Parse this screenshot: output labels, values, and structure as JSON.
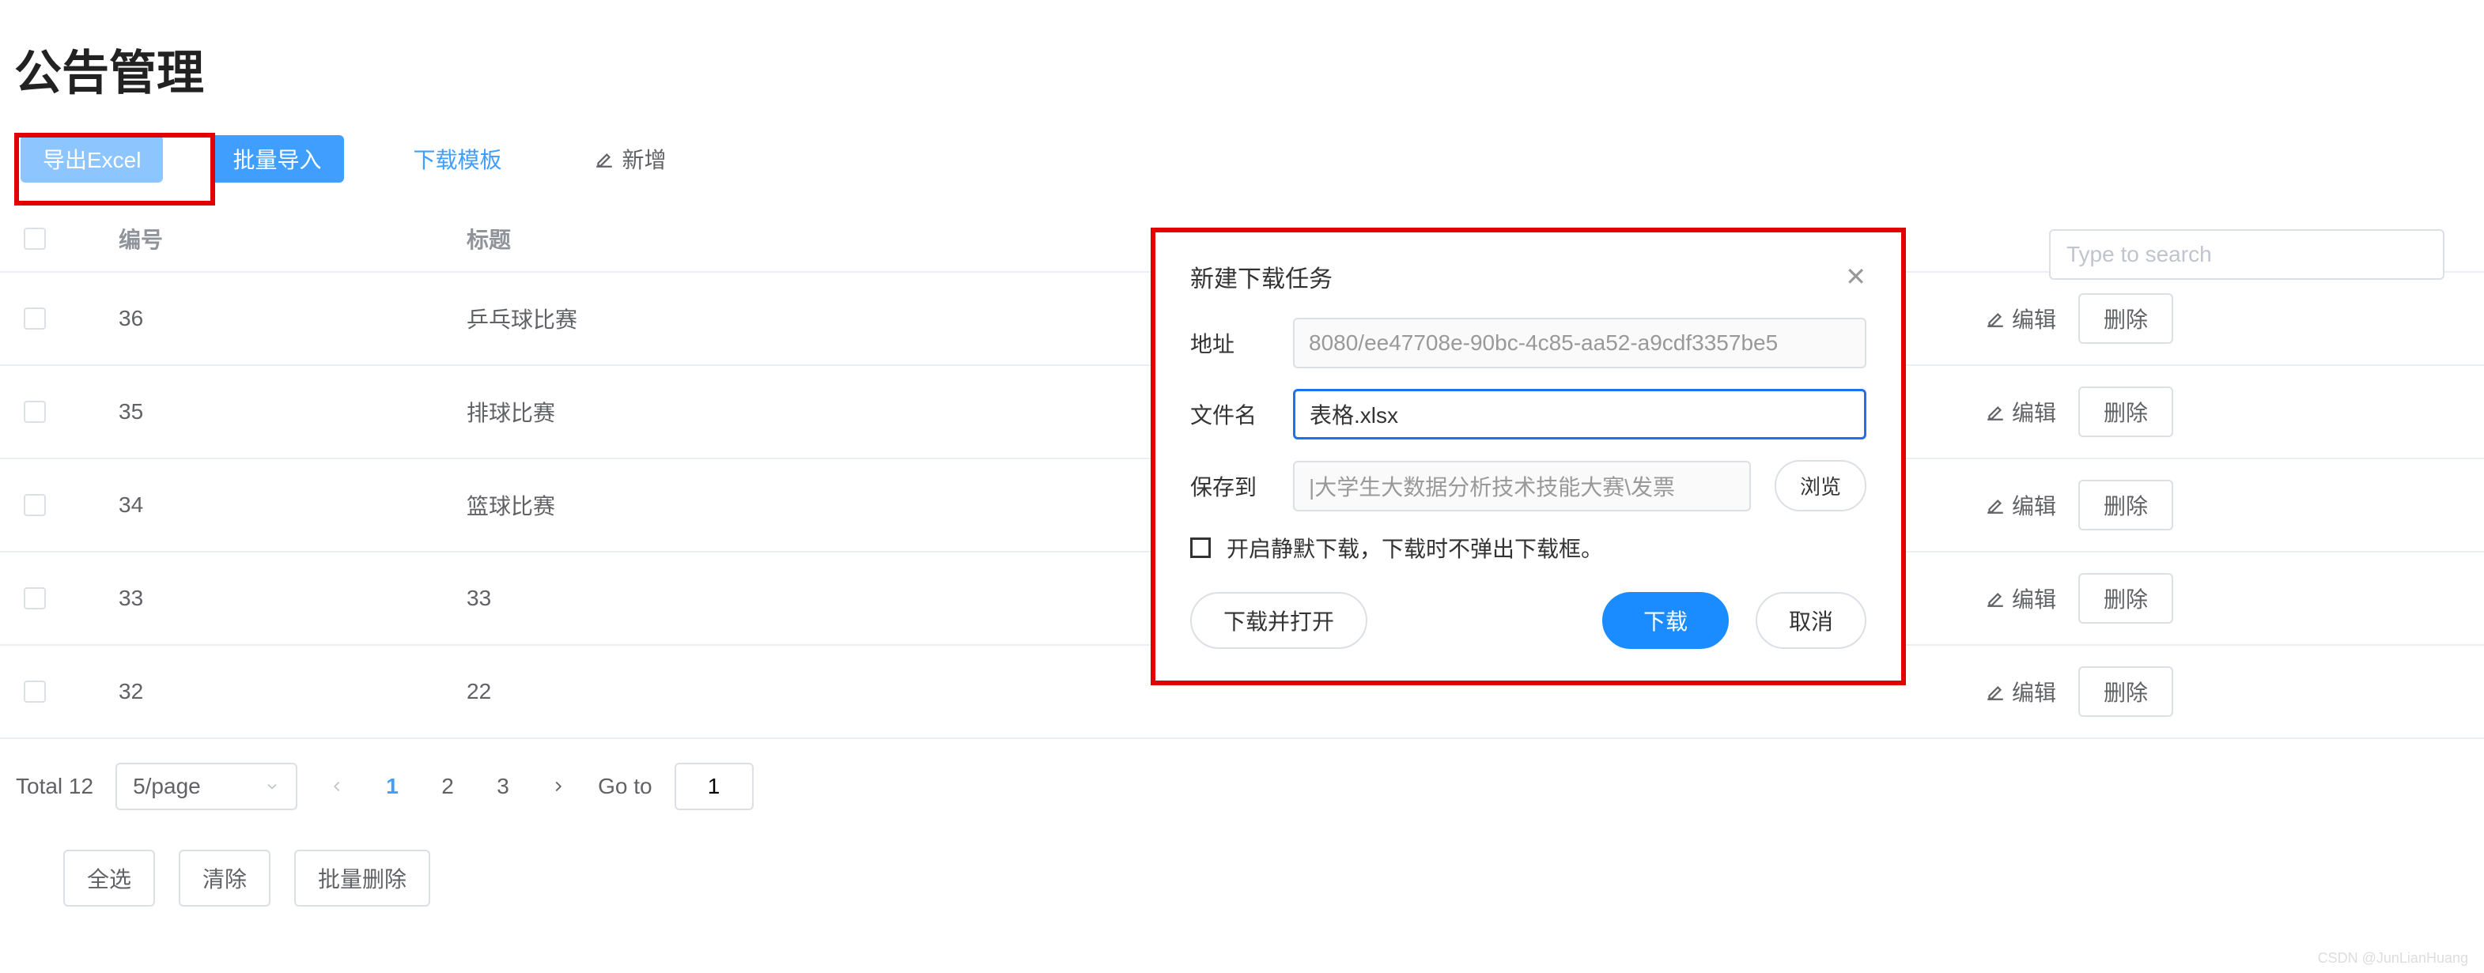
{
  "page": {
    "title": "公告管理"
  },
  "toolbar": {
    "export_label": "导出Excel",
    "batch_import_label": "批量导入",
    "download_template_label": "下载模板",
    "add_label": "新增"
  },
  "search": {
    "placeholder": "Type to search"
  },
  "table": {
    "header": {
      "id": "编号",
      "title": "标题"
    },
    "rows": [
      {
        "id": "36",
        "title": "乒乓球比赛"
      },
      {
        "id": "35",
        "title": "排球比赛"
      },
      {
        "id": "34",
        "title": "篮球比赛"
      },
      {
        "id": "33",
        "title": "33"
      },
      {
        "id": "32",
        "title": "22"
      }
    ],
    "ops": {
      "edit_label": "编辑",
      "delete_label": "删除"
    }
  },
  "pagination": {
    "total_label": "Total 12",
    "page_size_label": "5/page",
    "pages": [
      "1",
      "2",
      "3"
    ],
    "active_page": "1",
    "goto_label": "Go to",
    "goto_value": "1"
  },
  "bulk": {
    "select_all": "全选",
    "clear": "清除",
    "batch_delete": "批量删除"
  },
  "dialog": {
    "title": "新建下载任务",
    "url_label": "地址",
    "url_value": "8080/ee47708e-90bc-4c85-aa52-a9cdf3357be5",
    "filename_label": "文件名",
    "filename_value": "表格.xlsx",
    "saveto_label": "保存到",
    "saveto_value": "|大学生大数据分析技术技能大赛\\发票",
    "browse_label": "浏览",
    "silent_label": "开启静默下载，下载时不弹出下载框。",
    "download_open_label": "下载并打开",
    "download_label": "下载",
    "cancel_label": "取消"
  },
  "watermark": "CSDN @JunLianHuang"
}
